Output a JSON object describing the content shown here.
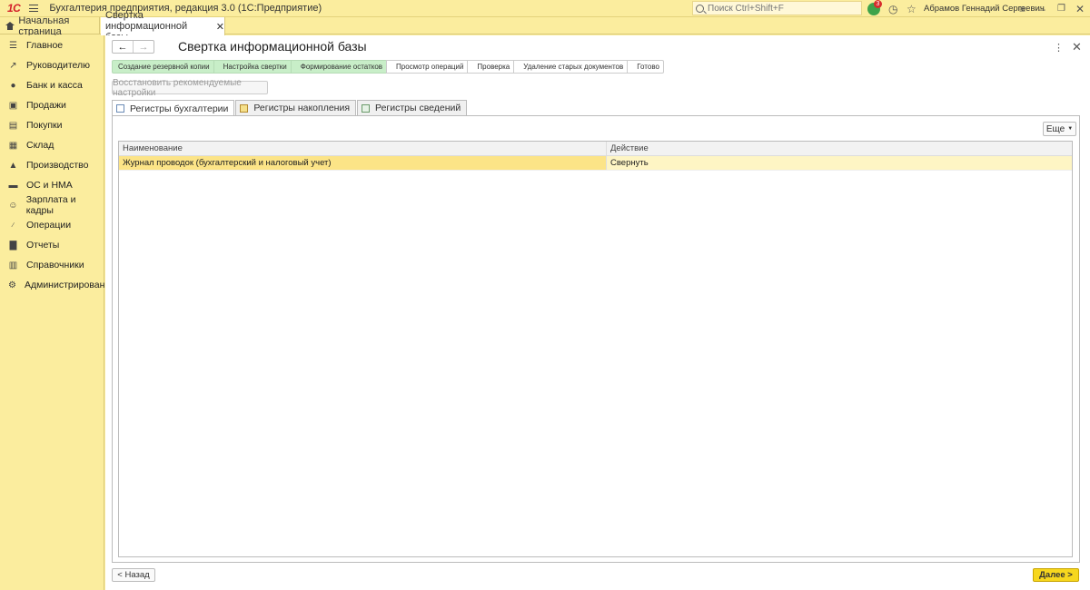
{
  "titlebar": {
    "logo": "1С",
    "app_title": "Бухгалтерия предприятия, редакция 3.0  (1С:Предприятие)",
    "search_placeholder": "Поиск Ctrl+Shift+F",
    "notification_count": "3",
    "user_name": "Абрамов Геннадий Сергеевич"
  },
  "tabbar": {
    "home_label": "Начальная страница",
    "doc_tab_label": "Свертка информационной базы"
  },
  "sidebar": {
    "items": [
      {
        "label": "Главное",
        "icon": "list-icon"
      },
      {
        "label": "Руководителю",
        "icon": "chart-line-icon"
      },
      {
        "label": "Банк и касса",
        "icon": "coins-icon"
      },
      {
        "label": "Продажи",
        "icon": "cart-icon"
      },
      {
        "label": "Покупки",
        "icon": "basket-icon"
      },
      {
        "label": "Склад",
        "icon": "warehouse-icon"
      },
      {
        "label": "Производство",
        "icon": "factory-icon"
      },
      {
        "label": "ОС и НМА",
        "icon": "car-icon"
      },
      {
        "label": "Зарплата и кадры",
        "icon": "person-icon"
      },
      {
        "label": "Операции",
        "icon": "dtkt-icon"
      },
      {
        "label": "Отчеты",
        "icon": "bar-chart-icon"
      },
      {
        "label": "Справочники",
        "icon": "books-icon"
      },
      {
        "label": "Администрирование",
        "icon": "gear-icon"
      }
    ]
  },
  "main": {
    "title": "Свертка информационной базы",
    "steps": [
      {
        "label": "Создание резервной копии",
        "done": true
      },
      {
        "label": "Настройка свертки",
        "done": true
      },
      {
        "label": "Формирование остатков",
        "done": true
      },
      {
        "label": "Просмотр операций",
        "done": false
      },
      {
        "label": "Проверка",
        "done": false
      },
      {
        "label": "Удаление старых документов",
        "done": false
      },
      {
        "label": "Готово",
        "done": false
      }
    ],
    "restore_label": "Восстановить рекомендуемые настройки",
    "tabs": [
      {
        "label": "Регистры бухгалтерии"
      },
      {
        "label": "Регистры накопления"
      },
      {
        "label": "Регистры сведений"
      }
    ],
    "more_label": "Еще",
    "grid": {
      "columns": [
        "Наименование",
        "Действие"
      ],
      "rows": [
        [
          "Журнал проводок (бухгалтерский и налоговый учет)",
          "Свернуть"
        ]
      ]
    },
    "back_label": "< Назад",
    "next_label": "Далее >"
  }
}
